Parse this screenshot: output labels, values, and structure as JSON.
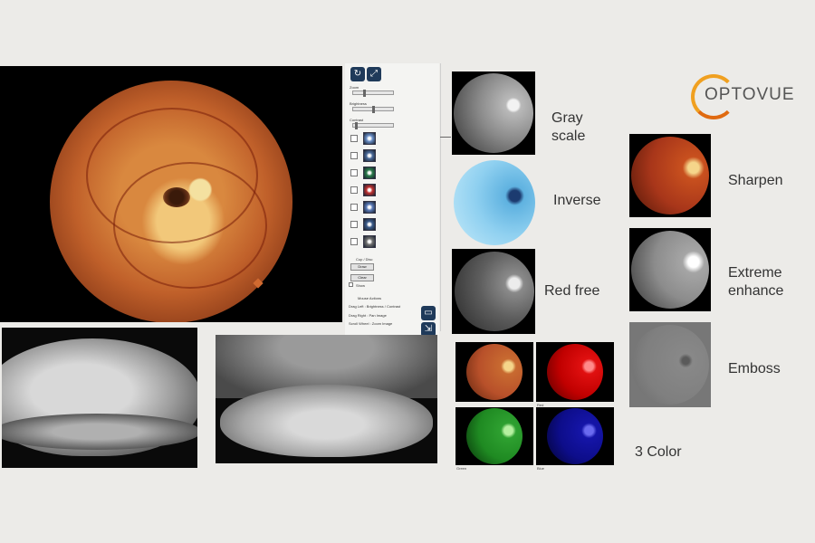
{
  "logo": {
    "text": "OPTOVUE"
  },
  "panel": {
    "zoom_label": "Zoom",
    "brightness_label": "Brightness",
    "contrast_label": "Contrast",
    "levels": {
      "zoom": 0.25,
      "brightness": 0.5,
      "contrast": 0.05
    },
    "cup_disc_label": "Cup / Disc",
    "draw_label": "Draw",
    "clear_label": "Clear",
    "show_label": "Show",
    "mouse_actions_label": "Mouse Actions",
    "hint_drag_left": "Drag Left   : Brightness / Contrast",
    "hint_drag_right": "Drag Right  : Pan Image",
    "hint_scroll": "Scroll Wheel : Zoom Image",
    "filters": [
      "color-filter-icon",
      "grayscale-filter-icon",
      "rgb-filter-icon",
      "channel-filter-icon",
      "inverse-filter-icon",
      "enhance-filter-icon",
      "emboss-filter-icon"
    ]
  },
  "labels": {
    "gray_scale_1": "Gray",
    "gray_scale_2": "scale",
    "inverse": "Inverse",
    "red_free": "Red free",
    "sharpen": "Sharpen",
    "extreme_1": "Extreme",
    "extreme_2": "enhance",
    "emboss": "Emboss",
    "three_color": "3 Color"
  },
  "channel_captions": {
    "red": "Red",
    "green": "Green",
    "blue": "Blue"
  },
  "colors": {
    "background": "#ecebe8",
    "logo_orange": "#f0a020",
    "tool_button": "#1f3a5a"
  }
}
